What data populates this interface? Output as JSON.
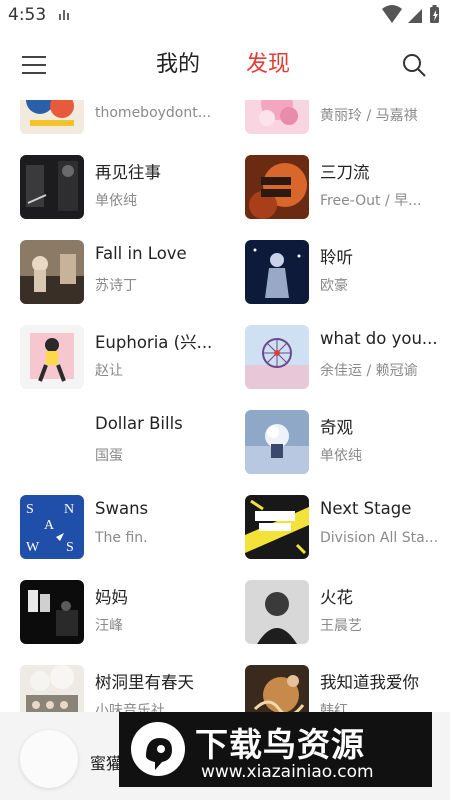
{
  "status_bar": {
    "time": "4:53"
  },
  "header": {
    "tab_mine": "我的",
    "tab_discover": "发现",
    "active_tab": "发现",
    "accent_color": "#e23d33"
  },
  "grid": {
    "items": [
      {
        "title": "",
        "artist": "thomeboydont...",
        "cover": "cover-thomeboy"
      },
      {
        "title": "",
        "artist": "黄丽玲 / 马嘉祺",
        "cover": "cover-pink"
      },
      {
        "title": "再见往事",
        "artist": "单依纯",
        "cover": "cover-zaijian"
      },
      {
        "title": "三刀流",
        "artist": "Free-Out / 早...",
        "cover": "cover-freeout"
      },
      {
        "title": "Fall in Love",
        "artist": "苏诗丁",
        "cover": "cover-fallinlove"
      },
      {
        "title": "聆听",
        "artist": "欧豪",
        "cover": "cover-lingting"
      },
      {
        "title": "Euphoria (兴...",
        "artist": "赵让",
        "cover": "cover-euphoria"
      },
      {
        "title": "what do you...",
        "artist": "余佳运 / 赖冠谕",
        "cover": "cover-ferris"
      },
      {
        "title": "Dollar Bills",
        "artist": "国蛋",
        "cover": ""
      },
      {
        "title": "奇观",
        "artist": "单依纯",
        "cover": "cover-qiguan"
      },
      {
        "title": "Swans",
        "artist": "The fin.",
        "cover": "cover-swans"
      },
      {
        "title": "Next Stage",
        "artist": "Division All Sta...",
        "cover": "cover-nextstage"
      },
      {
        "title": "妈妈",
        "artist": "汪峰",
        "cover": "cover-mama"
      },
      {
        "title": "火花",
        "artist": "王晨艺",
        "cover": "cover-huohua"
      },
      {
        "title": "树洞里有春天",
        "artist": "小味音乐社",
        "cover": "cover-shudong"
      },
      {
        "title": "我知道我爱你",
        "artist": "韩红",
        "cover": "cover-wozhidao"
      }
    ]
  },
  "player": {
    "song": "蜜獾"
  },
  "watermark": {
    "title": "下载鸟资源",
    "url": "www.xiazainiao.com"
  }
}
